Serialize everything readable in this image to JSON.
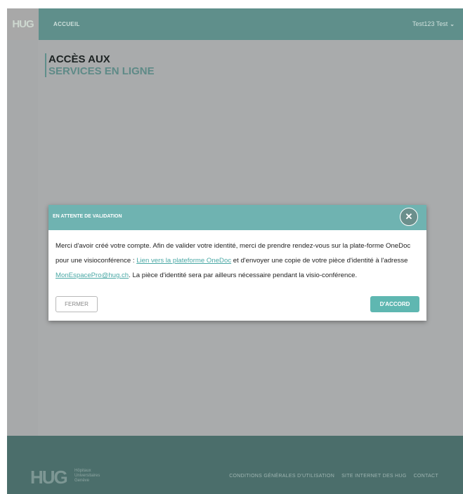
{
  "header": {
    "logo": "HUG",
    "nav_home": "ACCUEIL",
    "user_name": "Test123 Test",
    "user_chevron": "⌄"
  },
  "page": {
    "title_line1": "ACCÈS AUX",
    "title_line2": "SERVICES EN LIGNE"
  },
  "modal": {
    "title": "EN ATTENTE DE VALIDATION",
    "close_icon": "✕",
    "text_part1": "Merci d'avoir créé votre compte. Afin de valider votre identité, merci de prendre rendez-vous sur la plate-forme OneDoc pour une visioconférence : ",
    "link_onedoc": "Lien vers la plateforme OneDoc",
    "text_part2": " et d'envoyer une copie de votre pièce d'identité à l'adresse ",
    "link_email": "MonEspacePro@hug.ch",
    "text_part3": ". La pièce d'identité sera par ailleurs nécessaire pendant la visio-conférence.",
    "btn_close": "FERMER",
    "btn_ok": "D'ACCORD"
  },
  "footer": {
    "logo": "HUG",
    "logo_sub_1": "Hôpitaux",
    "logo_sub_2": "Universitaires",
    "logo_sub_3": "Genève",
    "links": [
      "CONDITIONS GÉNÉRALES D'UTILISATION",
      "SITE INTERNET DES HUG",
      "CONTACT"
    ]
  },
  "colors": {
    "header_bg": "#5f8f8b",
    "modal_header": "#6fb3b1",
    "accent": "#5fb7b1",
    "footer_bg": "#4b6e6b"
  }
}
